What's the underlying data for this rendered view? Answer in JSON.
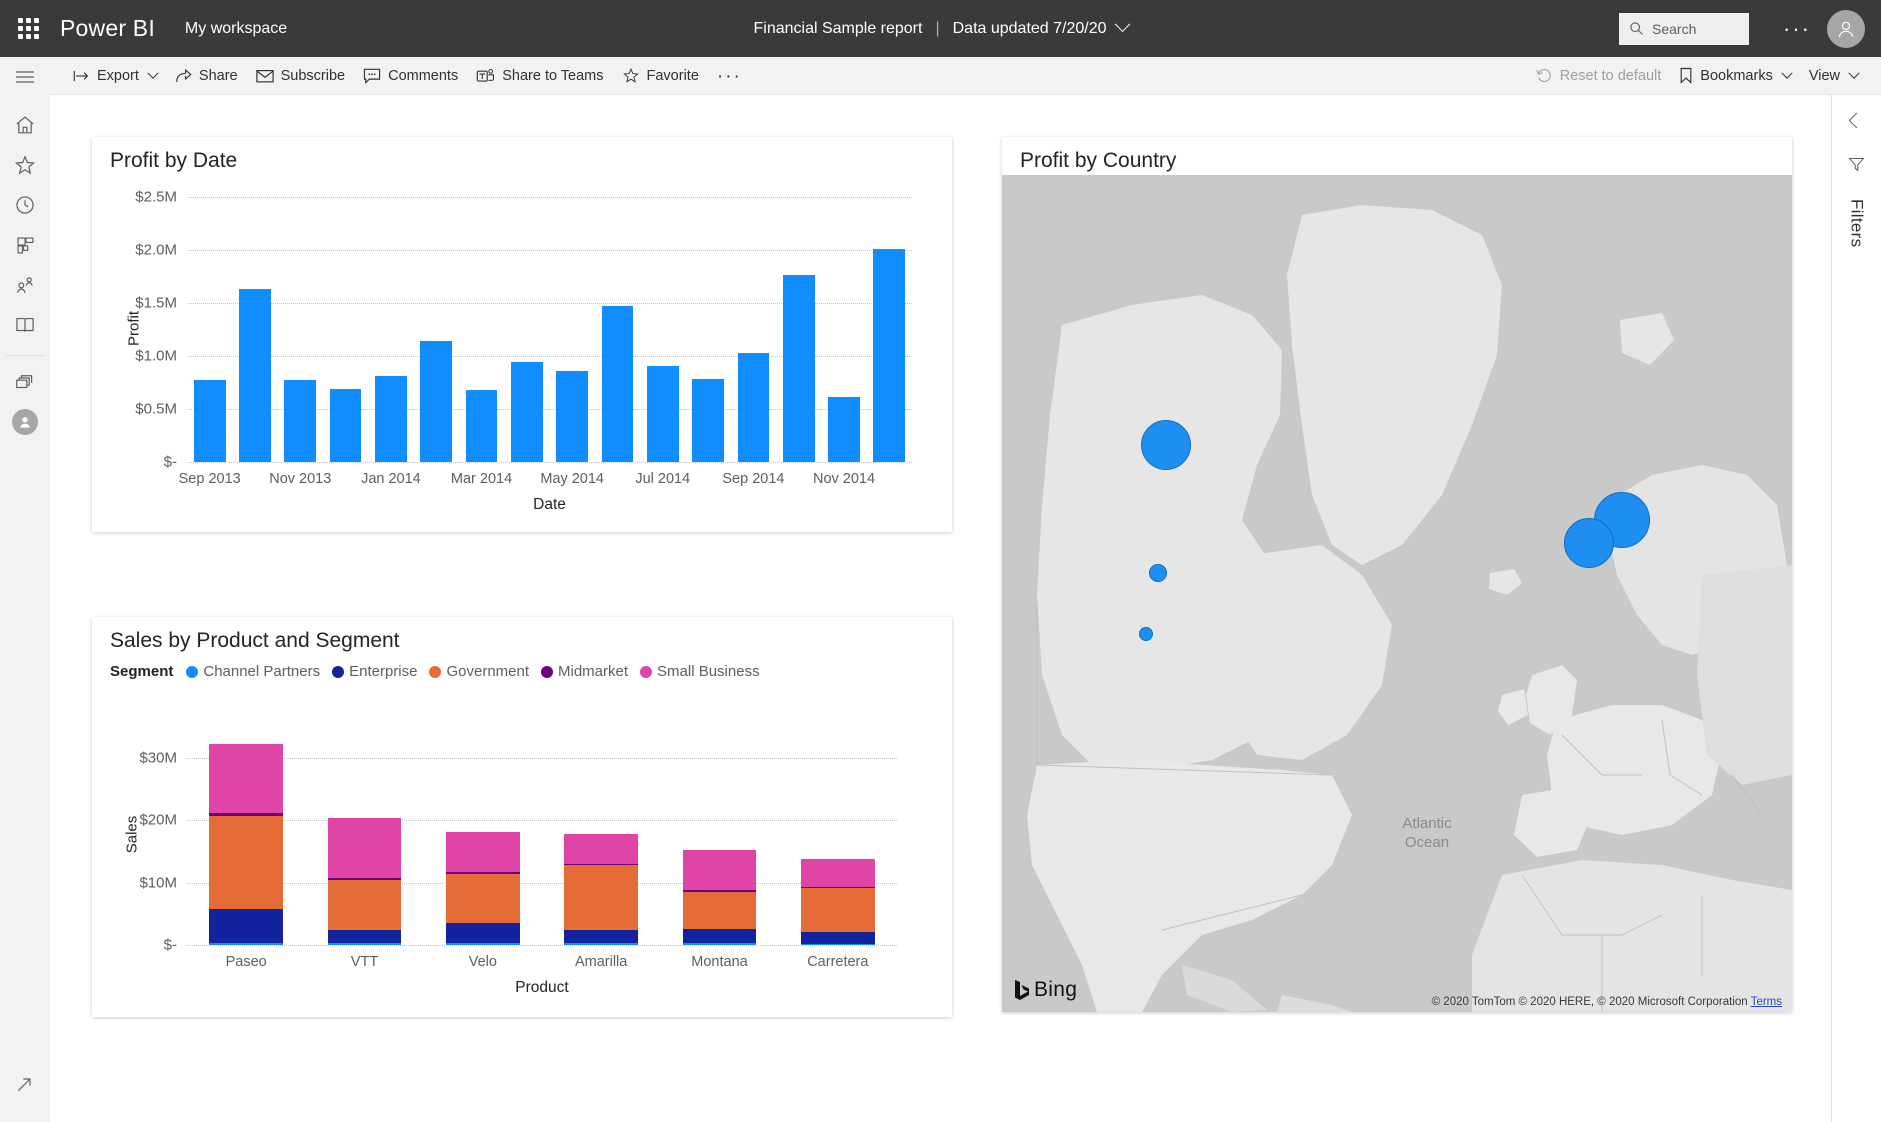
{
  "topbar": {
    "waffle_icon": "waffle-grid-icon",
    "brand": "Power BI",
    "workspace": "My workspace",
    "report_title": "Financial Sample report",
    "separator": "|",
    "data_updated": "Data updated 7/20/20",
    "chevron_icon": "chevron-down-icon",
    "search_placeholder": "Search",
    "search_value": "",
    "search_icon": "search-icon",
    "more_icon": "ellipsis-icon",
    "avatar_icon": "user-avatar-icon"
  },
  "toolbar": {
    "items": [
      {
        "label": "Export",
        "icon": "export-icon",
        "caret": true,
        "dim": false
      },
      {
        "label": "Share",
        "icon": "share-icon",
        "caret": false,
        "dim": false
      },
      {
        "label": "Subscribe",
        "icon": "envelope-icon",
        "caret": false,
        "dim": false
      },
      {
        "label": "Comments",
        "icon": "comment-icon",
        "caret": false,
        "dim": false
      },
      {
        "label": "Share to Teams",
        "icon": "teams-icon",
        "caret": false,
        "dim": false
      },
      {
        "label": "Favorite",
        "icon": "star-icon",
        "caret": false,
        "dim": false
      },
      {
        "label": "···",
        "icon": "ellipsis-icon",
        "caret": false,
        "dim": false
      }
    ],
    "right_items": [
      {
        "label": "Reset to default",
        "icon": "reset-icon",
        "caret": false,
        "dim": true
      },
      {
        "label": "Bookmarks",
        "icon": "bookmark-icon",
        "caret": true,
        "dim": false
      },
      {
        "label": "View",
        "icon": "",
        "caret": true,
        "dim": false
      }
    ]
  },
  "leftnav": {
    "items": [
      {
        "name": "hamburger-icon",
        "label": "Navigation"
      },
      {
        "name": "home-icon",
        "label": "Home"
      },
      {
        "name": "star-icon",
        "label": "Favorites"
      },
      {
        "name": "clock-icon",
        "label": "Recent"
      },
      {
        "name": "apps-icon",
        "label": "Apps"
      },
      {
        "name": "shared-with-me-icon",
        "label": "Shared with me"
      },
      {
        "name": "learn-book-icon",
        "label": "Learn"
      },
      {
        "name": "workspaces-icon",
        "label": "Workspaces"
      },
      {
        "name": "my-workspace-avatar-icon",
        "label": "My workspace"
      }
    ],
    "expand_icon": "expand-arrow-icon"
  },
  "filters_rail": {
    "collapse_icon": "chevron-left-icon",
    "filter_icon": "filter-funnel-icon",
    "label": "Filters"
  },
  "map": {
    "title": "Profit by Country",
    "ocean_label": "Atlantic\nOcean",
    "ocean_label_line1": "Atlantic",
    "ocean_label_line2": "Ocean",
    "provider": "Bing",
    "attribution": "© 2020 TomTom © 2020 HERE, © 2020 Microsoft Corporation",
    "terms_link": "Terms",
    "bubble_color": "#1f8ef1",
    "bubbles": [
      {
        "country": "Canada",
        "x": 164,
        "y": 270,
        "r": 25
      },
      {
        "country": "United States of America",
        "x": 156,
        "y": 398,
        "r": 9
      },
      {
        "country": "Mexico",
        "x": 144,
        "y": 459,
        "r": 7
      },
      {
        "country": "Germany",
        "x": 620,
        "y": 345,
        "r": 28
      },
      {
        "country": "France",
        "x": 587,
        "y": 368,
        "r": 25
      }
    ]
  },
  "chart_data": [
    {
      "id": "profit-by-date",
      "type": "bar",
      "title": "Profit by Date",
      "xlabel": "Date",
      "ylabel": "Profit",
      "ylim": [
        0,
        2500000
      ],
      "ytick_labels": [
        "$2.5M",
        "$2.0M",
        "$1.5M",
        "$1.0M",
        "$0.5M",
        "$-"
      ],
      "ytick_values": [
        2500000,
        2000000,
        1500000,
        1000000,
        500000,
        0
      ],
      "grid": true,
      "bar_color": "#118DFF",
      "categories": [
        "Sep 2013",
        "Oct 2013",
        "Nov 2013",
        "Dec 2013",
        "Jan 2014",
        "Feb 2014",
        "Mar 2014",
        "Apr 2014",
        "May 2014",
        "Jun 2014",
        "Jul 2014",
        "Aug 2014",
        "Sep 2014",
        "Oct 2014",
        "Nov 2014",
        "Dec 2014"
      ],
      "xtick_labels": [
        "Sep 2013",
        "Nov 2013",
        "Jan 2014",
        "Mar 2014",
        "May 2014",
        "Jul 2014",
        "Sep 2014",
        "Nov 2014"
      ],
      "values": [
        770000,
        1630000,
        770000,
        690000,
        810000,
        1140000,
        680000,
        940000,
        860000,
        1470000,
        910000,
        780000,
        1030000,
        1760000,
        610000,
        2010000
      ]
    },
    {
      "id": "sales-by-product-and-segment",
      "type": "bar",
      "stacked": true,
      "title": "Sales by Product and Segment",
      "xlabel": "Product",
      "ylabel": "Sales",
      "ylim": [
        0,
        35000000
      ],
      "ytick_labels": [
        "$30M",
        "$20M",
        "$10M",
        "$-"
      ],
      "ytick_values": [
        30000000,
        20000000,
        10000000,
        0
      ],
      "grid": true,
      "legend_title": "Segment",
      "legend_position": "top",
      "categories": [
        "Paseo",
        "VTT",
        "Velo",
        "Amarilla",
        "Montana",
        "Carretera"
      ],
      "series": [
        {
          "name": "Channel Partners",
          "color": "#118DFF",
          "values": [
            400000,
            300000,
            280000,
            300000,
            250000,
            220000
          ]
        },
        {
          "name": "Enterprise",
          "color": "#12239E",
          "values": [
            5400000,
            2100000,
            3200000,
            2100000,
            2400000,
            1800000
          ]
        },
        {
          "name": "Government",
          "color": "#E66C37",
          "values": [
            14900000,
            8100000,
            7900000,
            10400000,
            5900000,
            7100000
          ]
        },
        {
          "name": "Midmarket",
          "color": "#6B007B",
          "values": [
            500000,
            250000,
            300000,
            250000,
            250000,
            150000
          ]
        },
        {
          "name": "Small Business",
          "color": "#E044A7",
          "values": [
            11000000,
            9700000,
            6400000,
            4700000,
            6500000,
            4500000
          ]
        }
      ]
    }
  ]
}
